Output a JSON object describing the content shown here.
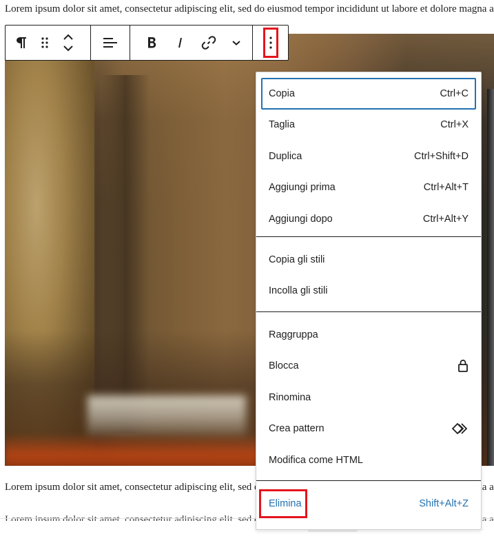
{
  "content": {
    "para_top": "Lorem ipsum dolor sit amet, consectetur adipiscing elit, sed do eiusmod tempor incididunt ut labore et dolore magna aliqua.",
    "para_bottom": "Lorem ipsum dolor sit amet, consectetur adipiscing elit, sed do eiusmod tempor incididunt ut labore et dolore magna aliqua.",
    "para_clipped": "Lorem ipsum dolor sit amet, consectetur adipiscing elit, sed do eiusmod tempor incididunt ut labore et dolore magna aliqua."
  },
  "toolbar": {
    "buttons": [
      {
        "name": "paragraph-icon"
      },
      {
        "name": "drag-handle-icon"
      },
      {
        "name": "move-up-down-icon"
      },
      {
        "name": "align-icon"
      },
      {
        "name": "bold-icon"
      },
      {
        "name": "italic-icon"
      },
      {
        "name": "link-icon"
      },
      {
        "name": "chevron-down-icon"
      },
      {
        "name": "more-options-icon",
        "highlighted": true
      }
    ]
  },
  "menu": {
    "section1": [
      {
        "label": "Copia",
        "shortcut": "Ctrl+C",
        "focused": true
      },
      {
        "label": "Taglia",
        "shortcut": "Ctrl+X"
      },
      {
        "label": "Duplica",
        "shortcut": "Ctrl+Shift+D"
      },
      {
        "label": "Aggiungi prima",
        "shortcut": "Ctrl+Alt+T"
      },
      {
        "label": "Aggiungi dopo",
        "shortcut": "Ctrl+Alt+Y"
      }
    ],
    "section2": [
      {
        "label": "Copia gli stili"
      },
      {
        "label": "Incolla gli stili"
      }
    ],
    "section3": [
      {
        "label": "Raggruppa"
      },
      {
        "label": "Blocca",
        "icon": "lock-icon"
      },
      {
        "label": "Rinomina"
      },
      {
        "label": "Crea pattern",
        "icon": "pattern-icon"
      },
      {
        "label": "Modifica come HTML"
      }
    ],
    "section4": [
      {
        "label": "Elimina",
        "shortcut": "Shift+Alt+Z",
        "highlighted": true
      }
    ]
  },
  "colors": {
    "accent": "#2271b1",
    "highlight": "#e5131c",
    "text": "#1e1e1e"
  }
}
